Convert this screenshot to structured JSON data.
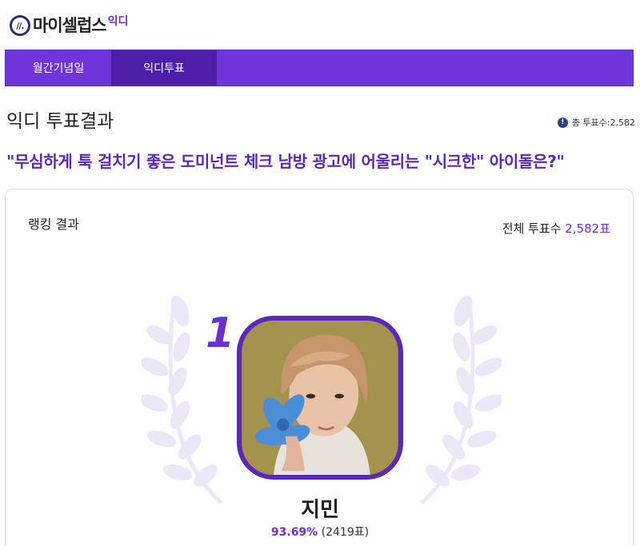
{
  "brand": {
    "name": "마이셀럽스",
    "sub": "익디",
    "mark": "//."
  },
  "nav": {
    "items": [
      {
        "label": "월간기념일"
      },
      {
        "label": "익디투표"
      }
    ]
  },
  "page": {
    "section_title": "익디 투표결과",
    "total_votes_label": "총 투표수:2,582"
  },
  "question": "\"무심하게 툭 걸치기 좋은 도미넌트 체크 남방 광고에 어울리는 \"시크한\" 아이돌은?\"",
  "ranking": {
    "title": "랭킹 결과",
    "total_label": "전체 투표수",
    "total_value": "2,582표",
    "winner": {
      "rank": "1",
      "name": "지민",
      "percent": "93.69%",
      "count": "(2419표)"
    }
  },
  "colors": {
    "accent": "#6f35d8",
    "accent_dark": "#4d1fa8",
    "info": "#2b3f8c"
  },
  "icons": {
    "info": "info-icon",
    "logo": "logo-mark-icon",
    "laurel": "laurel-icon"
  }
}
